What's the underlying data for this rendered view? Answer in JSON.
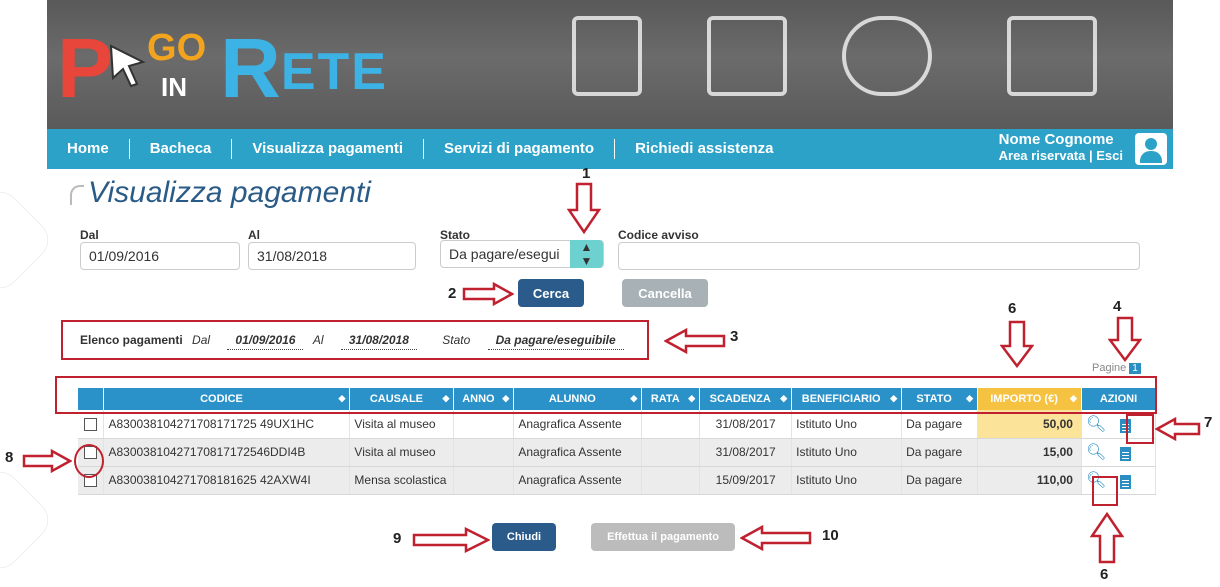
{
  "nav": {
    "items": [
      "Home",
      "Bacheca",
      "Visualizza pagamenti",
      "Servizi di pagamento",
      "Richiedi assistenza"
    ],
    "user_name": "Nome Cognome",
    "user_area": "Area riservata",
    "user_sep": "|",
    "user_logout": "Esci"
  },
  "page_title": "Visualizza pagamenti",
  "filters": {
    "dal_label": "Dal",
    "dal_value": "01/09/2016",
    "al_label": "Al",
    "al_value": "31/08/2018",
    "stato_label": "Stato",
    "stato_value": "Da pagare/esegui",
    "codice_label": "Codice avviso",
    "codice_value": "",
    "search_button": "Cerca",
    "cancel_button": "Cancella"
  },
  "summary": {
    "label": "Elenco pagamenti",
    "dal_label": "Dal",
    "dal_value": "01/09/2016",
    "al_label": "Al",
    "al_value": "31/08/2018",
    "stato_label": "Stato",
    "stato_value": "Da pagare/eseguibile"
  },
  "pages": {
    "label": "Pagine",
    "current": "1"
  },
  "table": {
    "headers": [
      "CODICE",
      "CAUSALE",
      "ANNO",
      "ALUNNO",
      "RATA",
      "SCADENZA",
      "BENEFICIARIO",
      "STATO",
      "IMPORTO (€)",
      "AZIONI"
    ],
    "rows": [
      {
        "codice": "A830038104271708171725 49UX1HC",
        "causale": "Visita al museo",
        "anno": "",
        "alunno": "Anagrafica Assente",
        "rata": "",
        "scadenza": "31/08/2017",
        "beneficiario": "Istituto Uno",
        "stato": "Da pagare",
        "importo": "50,00"
      },
      {
        "codice": "A83003810427170817172546DDI4B",
        "causale": "Visita al museo",
        "anno": "",
        "alunno": "Anagrafica Assente",
        "rata": "",
        "scadenza": "31/08/2017",
        "beneficiario": "Istituto Uno",
        "stato": "Da pagare",
        "importo": "15,00"
      },
      {
        "codice": "A830038104271708181625 42AXW4I",
        "causale": "Mensa scolastica",
        "anno": "",
        "alunno": "Anagrafica Assente",
        "rata": "",
        "scadenza": "15/09/2017",
        "beneficiario": "Istituto Uno",
        "stato": "Da pagare",
        "importo": "110,00"
      }
    ]
  },
  "buttons": {
    "close": "Chiudi",
    "pay": "Effettua il pagamento"
  },
  "annotations": [
    "1",
    "2",
    "3",
    "4",
    "6",
    "7",
    "8",
    "9",
    "10",
    "6"
  ],
  "colors": {
    "nav_blue": "#2ca2c8",
    "table_head": "#2a92c9",
    "importo_head": "#f6c242",
    "importo_cell": "#fbe39a",
    "primary_btn": "#2a5b8a",
    "annotation_red": "#c0212f"
  }
}
